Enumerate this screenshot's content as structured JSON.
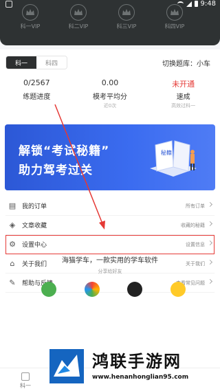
{
  "status": {
    "time": "9:48"
  },
  "vip": [
    {
      "label": "科一VIP"
    },
    {
      "label": "科二VIP"
    },
    {
      "label": "科三VIP"
    },
    {
      "label": "科四VIP"
    }
  ],
  "tabs": [
    {
      "label": "科一"
    },
    {
      "label": "科四"
    }
  ],
  "switch_bank": "切换题库：小车",
  "stats": [
    {
      "value": "0/2567",
      "name": "练题进度",
      "sub": ""
    },
    {
      "value": "0.00",
      "name": "模考平均分",
      "sub": "近0次"
    },
    {
      "value": "未开通",
      "name": "速成",
      "sub": "高效过科一"
    }
  ],
  "banner": {
    "line1": "解锁“考试秘籍”",
    "line2": "助力驾考过关",
    "book_text": "秘籍"
  },
  "menu": [
    {
      "icon": "orders-icon",
      "label": "我的订单",
      "right": "所有订单"
    },
    {
      "icon": "layers-icon",
      "label": "文章收藏",
      "right": "收藏的秘籍"
    },
    {
      "icon": "gear-icon",
      "label": "设置中心",
      "right": "设置信息"
    },
    {
      "icon": "store-icon",
      "label": "关于我们",
      "right": "关于我们"
    },
    {
      "icon": "feedback-icon",
      "label": "帮助与反馈",
      "right": "查看常见问题"
    }
  ],
  "share": {
    "slogan": "海猫学车，一款实用的学车软件",
    "hint": "分享给好友"
  },
  "bottom_nav": [
    {
      "label": "科一"
    }
  ],
  "watermark": {
    "title": "鸿联手游网",
    "url": "www.henanhonglian95.com"
  },
  "colors": {
    "accent_red": "#e53935",
    "banner_blue": "#3b6cf0",
    "header_dark": "#2e3233"
  }
}
